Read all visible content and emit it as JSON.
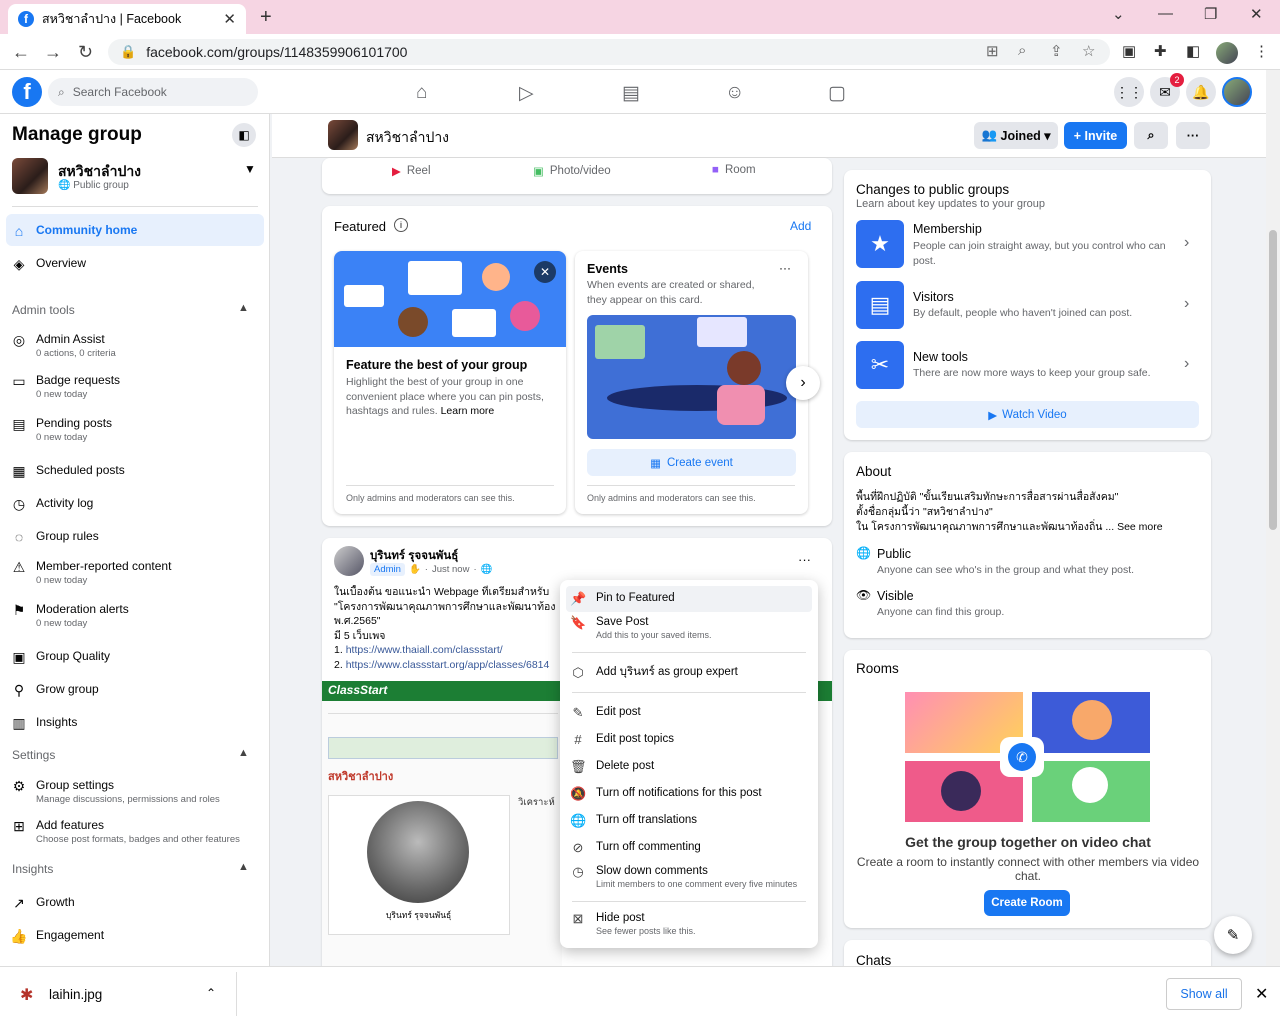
{
  "browser": {
    "tab_title": "สหวิชาลำปาง | Facebook",
    "url": "facebook.com/groups/1148359906101700"
  },
  "fb": {
    "search_placeholder": "Search Facebook",
    "notif_count": "2"
  },
  "sidebar": {
    "title": "Manage group",
    "group_name": "สหวิชาลำปาง",
    "group_type": "Public group",
    "top_items": [
      {
        "label": "Community home",
        "icon": "home-icon"
      },
      {
        "label": "Overview",
        "icon": "layers-icon"
      }
    ],
    "admin_tools_label": "Admin tools",
    "admin_items": [
      {
        "label": "Admin Assist",
        "sub": "0 actions, 0 criteria"
      },
      {
        "label": "Badge requests",
        "sub": "0 new today"
      },
      {
        "label": "Pending posts",
        "sub": "0 new today"
      },
      {
        "label": "Scheduled posts",
        "sub": ""
      },
      {
        "label": "Activity log",
        "sub": ""
      },
      {
        "label": "Group rules",
        "sub": ""
      },
      {
        "label": "Member-reported content",
        "sub": "0 new today"
      },
      {
        "label": "Moderation alerts",
        "sub": "0 new today"
      },
      {
        "label": "Group Quality",
        "sub": ""
      },
      {
        "label": "Grow group",
        "sub": ""
      },
      {
        "label": "Insights",
        "sub": ""
      }
    ],
    "settings_label": "Settings",
    "settings_items": [
      {
        "label": "Group settings",
        "sub": "Manage discussions, permissions and roles"
      },
      {
        "label": "Add features",
        "sub": "Choose post formats, badges and other features"
      }
    ],
    "insights_label": "Insights",
    "insights_items": [
      {
        "label": "Growth"
      },
      {
        "label": "Engagement"
      }
    ]
  },
  "group_header": {
    "name": "สหวิชาลำปาง",
    "joined": "Joined",
    "invite": "+ Invite"
  },
  "composer": {
    "reel": "Reel",
    "photo": "Photo/video",
    "room": "Room"
  },
  "featured": {
    "title": "Featured",
    "add": "Add",
    "card1": {
      "title": "Feature the best of your group",
      "body": "Highlight the best of your group in one convenient place where you can pin posts, hashtags and rules.",
      "learn": "Learn more",
      "foot": "Only admins and moderators can see this."
    },
    "card2": {
      "title": "Events",
      "body": "When events are created or shared, they appear on this card.",
      "button": "Create event",
      "foot": "Only admins and moderators can see this."
    }
  },
  "post": {
    "author": "บุรินทร์ รุจจนพันธุ์",
    "role": "Admin",
    "time": "Just now",
    "line1": "ในเบื้องต้น ขอแนะนำ Webpage ที่เตรียมสำหรับ",
    "line2": "\"โครงการพัฒนาคุณภาพการศึกษาและพัฒนาท้อง",
    "line3": "พ.ศ.2565\"",
    "line4": "มี 5 เว็บเพจ",
    "link1": "https://www.thaiall.com/classstart/",
    "link2": "https://www.classstart.org/app/classes/6814",
    "cs_logo": "ClassStart",
    "cs_title": "สหวิชาลำปาง",
    "cs_name": "บุรินทร์ รุจจนพันธุ์",
    "cs_col": "วิเคราะห์"
  },
  "menu": {
    "items": [
      {
        "label": "Pin to Featured",
        "sub": "",
        "icon": "pin-icon"
      },
      {
        "label": "Save Post",
        "sub": "Add this to your saved items.",
        "icon": "bookmark-icon"
      },
      {
        "label": "Add บุรินทร์ as group expert",
        "sub": "",
        "icon": "badge-icon"
      },
      {
        "label": "Edit post",
        "sub": "",
        "icon": "pencil-icon"
      },
      {
        "label": "Edit post topics",
        "sub": "",
        "icon": "hashtag-icon"
      },
      {
        "label": "Delete post",
        "sub": "",
        "icon": "trash-icon"
      },
      {
        "label": "Turn off notifications for this post",
        "sub": "",
        "icon": "bell-off-icon"
      },
      {
        "label": "Turn off translations",
        "sub": "",
        "icon": "globe-icon"
      },
      {
        "label": "Turn off commenting",
        "sub": "",
        "icon": "comment-off-icon"
      },
      {
        "label": "Slow down comments",
        "sub": "Limit members to one comment every five minutes",
        "icon": "clock-icon"
      },
      {
        "label": "Hide post",
        "sub": "See fewer posts like this.",
        "icon": "hide-icon"
      }
    ]
  },
  "changes": {
    "title": "Changes to public groups",
    "sub": "Learn about key updates to your group",
    "items": [
      {
        "title": "Membership",
        "sub": "People can join straight away, but you control who can post."
      },
      {
        "title": "Visitors",
        "sub": "By default, people who haven't joined can post."
      },
      {
        "title": "New tools",
        "sub": "There are now more ways to keep your group safe."
      }
    ],
    "video": "Watch Video"
  },
  "about": {
    "title": "About",
    "desc1": "พื้นที่ฝึกปฏิบัติ \"ขั้นเรียนเสริมทักษะการสื่อสารผ่านสื่อสังคม\"",
    "desc2": "ตั้งชื่อกลุ่มนี้ว่า \"สหวิชาลำปาง\"",
    "desc3": "ใน โครงการพัฒนาคุณภาพการศึกษาและพัฒนาท้องถิ่น ...",
    "see_more": "See more",
    "public": "Public",
    "public_sub": "Anyone can see who's in the group and what they post.",
    "visible": "Visible",
    "visible_sub": "Anyone can find this group."
  },
  "rooms": {
    "title": "Rooms",
    "heading": "Get the group together on video chat",
    "body": "Create a room to instantly connect with other members via video chat.",
    "button": "Create Room"
  },
  "chats": {
    "title": "Chats"
  },
  "download": {
    "file": "laihin.jpg",
    "show_all": "Show all"
  },
  "colors": {
    "brand": "#1877f2",
    "classstart": "#1c7e34"
  }
}
